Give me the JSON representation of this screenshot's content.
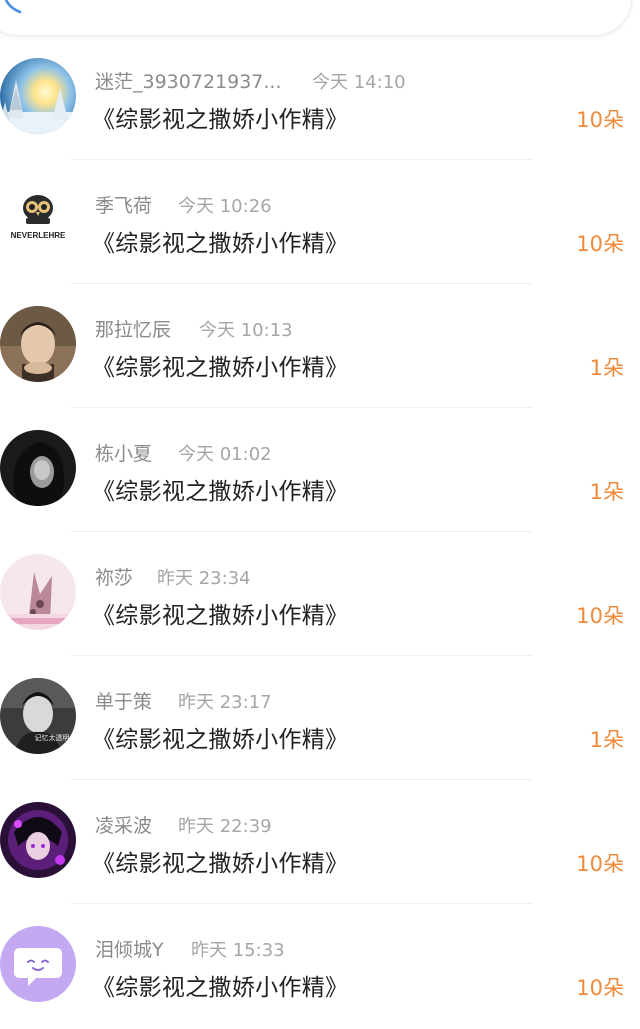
{
  "header": {
    "search_icon": "search-icon"
  },
  "accent_color": "#f08a3a",
  "items": [
    {
      "name": "迷茫_3930721937...",
      "time": "今天 14:10",
      "title": "《综影视之撒娇小作精》",
      "amount": "10朵",
      "avatar": "snowy-forest-sunrise"
    },
    {
      "name": "季飞荷",
      "time": "今天 10:26",
      "title": "《综影视之撒娇小作精》",
      "amount": "10朵",
      "avatar": "owl-logo",
      "avatar_text": "NEVERLEHRE"
    },
    {
      "name": "那拉忆辰",
      "time": "今天 10:13",
      "title": "《综影视之撒娇小作精》",
      "amount": "1朵",
      "avatar": "man-portrait"
    },
    {
      "name": "栋小夏",
      "time": "今天 01:02",
      "title": "《综影视之撒娇小作精》",
      "amount": "1朵",
      "avatar": "dark-portrait"
    },
    {
      "name": "祢莎",
      "time": "昨天 23:34",
      "title": "《综影视之撒娇小作精》",
      "amount": "10朵",
      "avatar": "pink-cat-illustration"
    },
    {
      "name": "单于策",
      "time": "昨天 23:17",
      "title": "《综影视之撒娇小作精》",
      "amount": "1朵",
      "avatar": "man-bw-portrait",
      "avatar_text": "记忆太透明"
    },
    {
      "name": "凌采波",
      "time": "昨天 22:39",
      "title": "《综影视之撒娇小作精》",
      "amount": "10朵",
      "avatar": "purple-anime-character"
    },
    {
      "name": "泪倾城Y",
      "time": "昨天 15:33",
      "title": "《综影视之撒娇小作精》",
      "amount": "10朵",
      "avatar": "lavender-chat-bubble"
    }
  ]
}
